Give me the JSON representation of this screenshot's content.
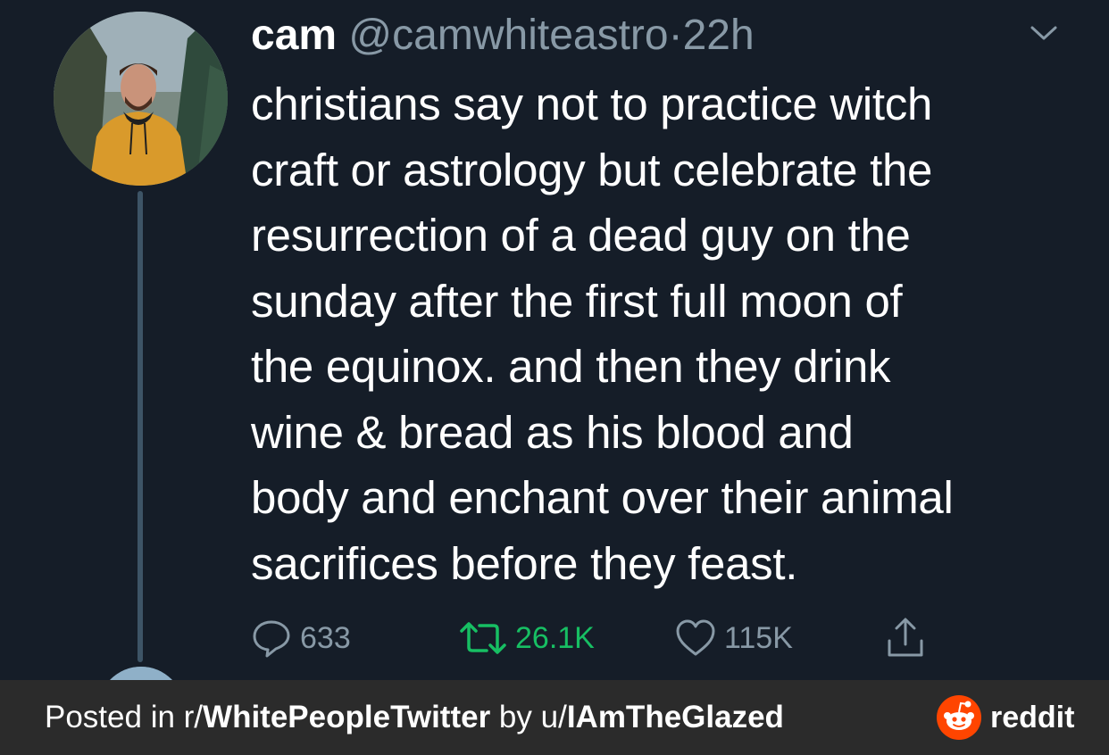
{
  "tweet": {
    "name": "cam",
    "handle": "@camwhiteastro",
    "separator": "·",
    "time": "22h",
    "lines": [
      "christians say not to practice witch",
      "craft or astrology but celebrate the",
      "resurrection of a dead guy on the",
      "sunday after the first full moon of",
      "the equinox. and then they drink",
      "wine & bread as his blood and",
      "body and enchant over their animal",
      "sacrifices before they feast."
    ],
    "actions": {
      "replies": "633",
      "retweets": "26.1K",
      "likes": "115K"
    },
    "icons": [
      "chevron-down-icon",
      "reply-icon",
      "retweet-icon",
      "heart-icon",
      "share-icon"
    ]
  },
  "footer": {
    "posted_in_prefix": "Posted in r/",
    "subreddit": "WhitePeopleTwitter",
    "by_prefix": " by u/",
    "username": "IAmTheGlazed",
    "brand": "reddit"
  },
  "colors": {
    "background": "#151d28",
    "text": "#ffffff",
    "muted": "#8899a6",
    "retweet": "#17bf63",
    "footer_bg": "#2b2b2b",
    "reddit_orange": "#ff4500"
  }
}
